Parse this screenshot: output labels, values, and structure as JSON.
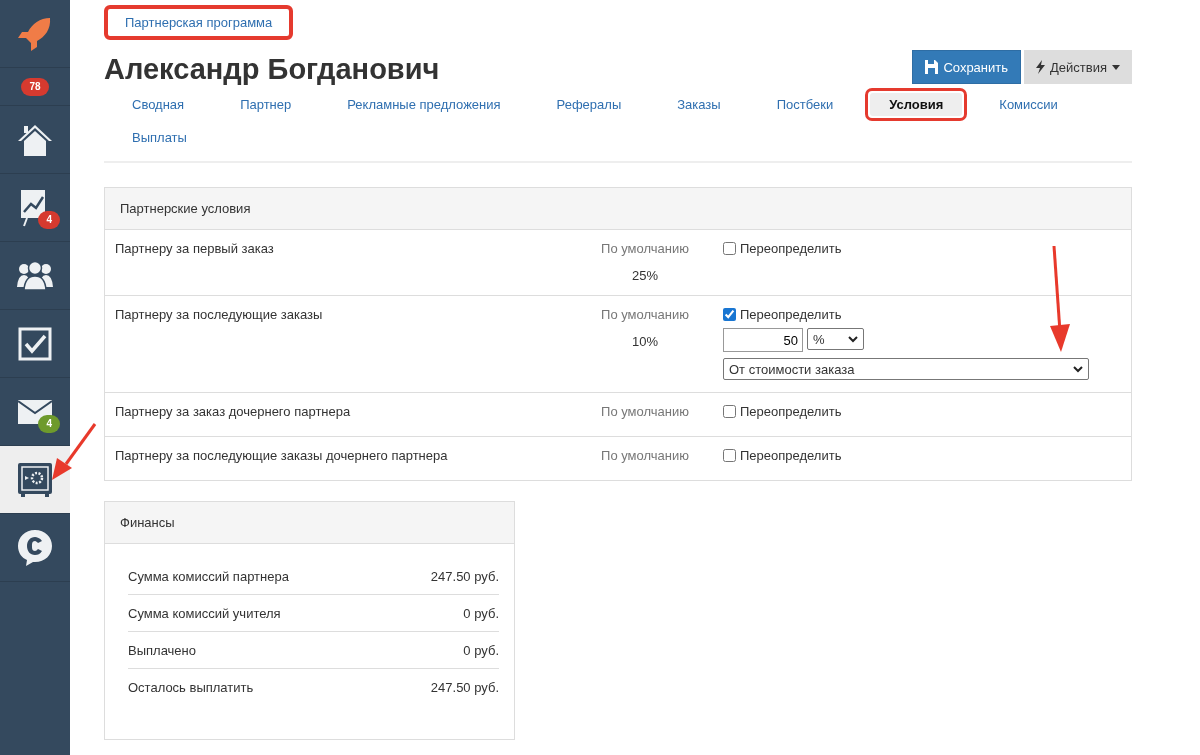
{
  "sidebar": {
    "items": [
      {
        "kind": "rocket",
        "selected": false
      },
      {
        "kind": "counter",
        "badge": "78",
        "color": "#d63a2f",
        "selected": false
      },
      {
        "kind": "home",
        "selected": false
      },
      {
        "kind": "chart",
        "badge": "4",
        "color": "#d63a2f",
        "selected": false
      },
      {
        "kind": "people",
        "selected": false
      },
      {
        "kind": "check",
        "selected": false
      },
      {
        "kind": "mail",
        "badge": "4",
        "color": "#6e9a2c",
        "selected": false
      },
      {
        "kind": "safe",
        "selected": true
      },
      {
        "kind": "chat",
        "selected": false
      }
    ]
  },
  "breadcrumb": {
    "label": "Партнерская программа",
    "highlighted": true
  },
  "title": "Александр Богданович",
  "buttons": [
    {
      "kind": "save",
      "label": "Сохранить"
    },
    {
      "kind": "actions",
      "label": "Действия"
    }
  ],
  "tabs": [
    {
      "label": "Сводная",
      "selected": false,
      "highlighted": false
    },
    {
      "label": "Партнер",
      "selected": false,
      "highlighted": false
    },
    {
      "label": "Рекламные предложения",
      "selected": false,
      "highlighted": false
    },
    {
      "label": "Рефералы",
      "selected": false,
      "highlighted": false
    },
    {
      "label": "Заказы",
      "selected": false,
      "highlighted": false
    },
    {
      "label": "Постбеки",
      "selected": false,
      "highlighted": false
    },
    {
      "label": "Условия",
      "selected": true,
      "highlighted": true
    },
    {
      "label": "Комиссии",
      "selected": false,
      "highlighted": false
    },
    {
      "label": "Выплаты",
      "selected": false,
      "highlighted": false
    }
  ],
  "conditions": {
    "title": "Партнерские условия",
    "rows": [
      {
        "label": "Партнеру за первый заказ",
        "default_label": "По умолчанию",
        "default_value": "25%",
        "override": {
          "label": "Переопределить",
          "checked": false
        }
      },
      {
        "label": "Партнеру за последующие заказы",
        "default_label": "По умолчанию",
        "default_value": "10%",
        "override": {
          "label": "Переопределить",
          "checked": true,
          "amount": "50",
          "unit": "%",
          "basis": "От стоимости заказа"
        }
      },
      {
        "label": "Партнеру за заказ дочернего партнера",
        "default_label": "По умолчанию",
        "override": {
          "label": "Переопределить",
          "checked": false
        }
      },
      {
        "label": "Партнеру за последующие заказы дочернего партнера",
        "default_label": "По умолчанию",
        "override": {
          "label": "Переопределить",
          "checked": false
        }
      }
    ]
  },
  "finance": {
    "title": "Финансы",
    "rows": [
      {
        "label": "Сумма комиссий партнера",
        "value": "247.50 руб."
      },
      {
        "label": "Сумма комиссий учителя",
        "value": "0 руб."
      },
      {
        "label": "Выплачено",
        "value": "0 руб."
      },
      {
        "label": "Осталось выплатить",
        "value": "247.50 руб."
      }
    ]
  }
}
